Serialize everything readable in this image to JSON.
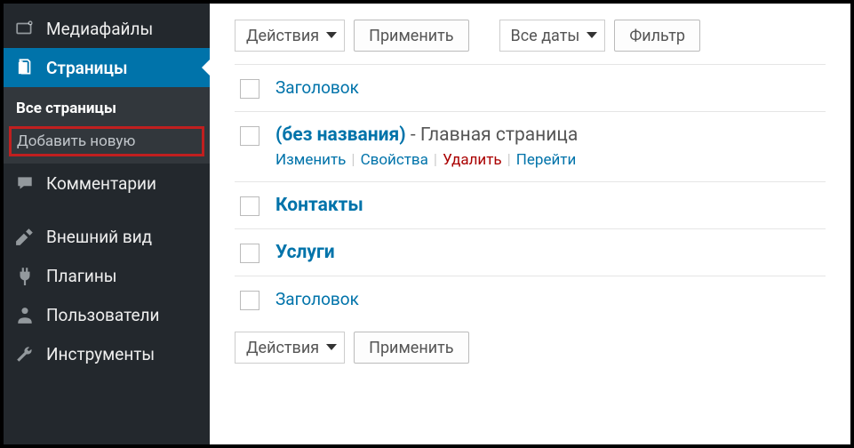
{
  "sidebar": {
    "items": [
      {
        "key": "media",
        "label": "Медиафайлы"
      },
      {
        "key": "pages",
        "label": "Страницы",
        "active": true,
        "sub": [
          {
            "key": "all",
            "label": "Все страницы",
            "current": true
          },
          {
            "key": "add",
            "label": "Добавить новую",
            "highlight": true
          }
        ]
      },
      {
        "key": "comments",
        "label": "Комментарии"
      },
      {
        "key": "appearance",
        "label": "Внешний вид"
      },
      {
        "key": "plugins",
        "label": "Плагины"
      },
      {
        "key": "users",
        "label": "Пользователи"
      },
      {
        "key": "tools",
        "label": "Инструменты"
      }
    ]
  },
  "toolbar": {
    "bulk_actions": "Действия",
    "apply": "Применить",
    "dates_filter": "Все даты",
    "filter": "Фильтр"
  },
  "columns": {
    "title": "Заголовок"
  },
  "rows": [
    {
      "title": "(без названия)",
      "suffix": " - Главная страница",
      "actions": {
        "edit": "Изменить",
        "quick": "Свойства",
        "trash": "Удалить",
        "view": "Перейти"
      }
    },
    {
      "title": "Контакты"
    },
    {
      "title": "Услуги"
    }
  ],
  "footer_header": {
    "title": "Заголовок"
  }
}
